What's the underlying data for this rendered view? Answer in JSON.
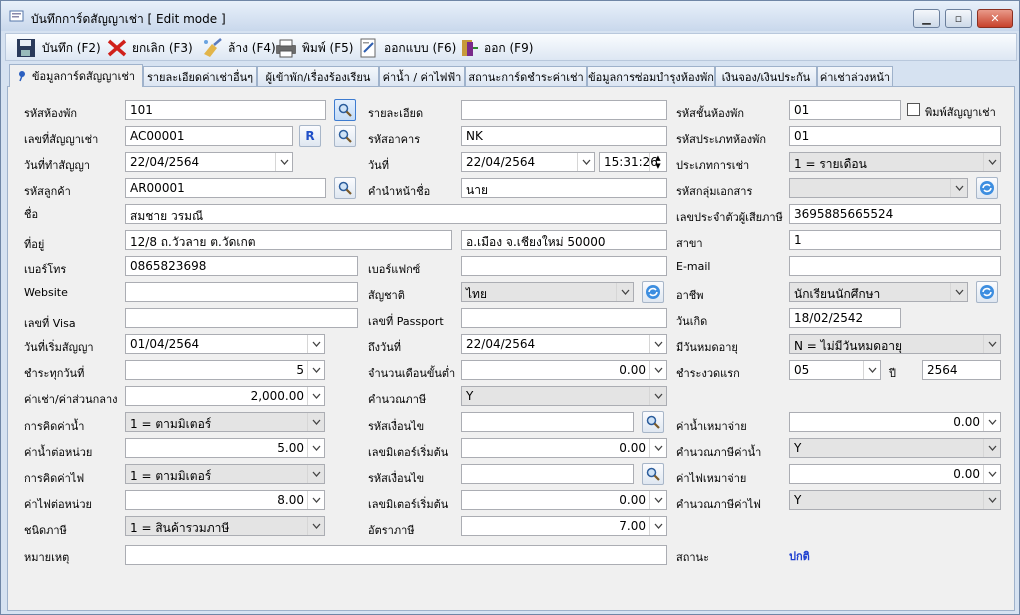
{
  "window": {
    "title": "บันทึกการ์ดสัญญาเช่า [ Edit mode ]"
  },
  "toolbar": {
    "save": "บันทึก (F2)",
    "cancel": "ยกเลิก (F3)",
    "clear": "ล้าง (F4)",
    "print": "พิมพ์ (F5)",
    "design": "ออกแบบ (F6)",
    "exit": "ออก (F9)"
  },
  "tabs": [
    "ข้อมูลการ์ดสัญญาเช่า",
    "รายละเอียดค่าเช่าอื่นๆ",
    "ผู้เข้าพัก/เรื่องร้องเรียน",
    "ค่าน้ำ / ค่าไฟฟ้า",
    "สถานะการ์ดชำระค่าเช่า",
    "ข้อมูลการซ่อมบำรุงห้องพัก",
    "เงินจอง/เงินประกัน",
    "ค่าเช่าล่วงหน้า"
  ],
  "labels": {
    "room_code": "รหัสห้องพัก",
    "detail": "รายละเอียด",
    "floor_code": "รหัสชั้นห้องพัก",
    "print_contract": "พิมพ์สัญญาเช่า",
    "contract_no": "เลขที่สัญญาเช่า",
    "building_code": "รหัสอาคาร",
    "room_type_code": "รหัสประเภทห้องพัก",
    "contract_date": "วันที่ทำสัญญา",
    "date": "วันที่",
    "rent_type": "ประเภทการเช่า",
    "customer_code": "รหัสลูกค้า",
    "prefix": "คำนำหน้าชื่อ",
    "doc_group": "รหัสกลุ่มเอกสาร",
    "name": "ชื่อ",
    "tax_id": "เลขประจำตัวผู้เสียภาษี",
    "address": "ที่อยู่",
    "branch": "สาขา",
    "phone": "เบอร์โทร",
    "fax": "เบอร์แฟกซ์",
    "email": "E-mail",
    "website": "Website",
    "nationality": "สัญชาติ",
    "occupation": "อาชีพ",
    "visa": "เลขที่ Visa",
    "passport": "เลขที่ Passport",
    "birthdate": "วันเกิด",
    "start_date": "วันที่เริ่มสัญญา",
    "end_date": "ถึงวันที่",
    "has_expiry": "มีวันหมดอายุ",
    "pay_every": "ชำระทุกวันที่",
    "min_months": "จำนวนเดือนขั้นต่ำ",
    "first_period": "ชำระงวดแรก",
    "year": "ปี",
    "rent_fee": "ค่าเช่า/ค่าส่วนกลาง",
    "calc_tax": "คำนวณภาษี",
    "water_calc": "การคิดค่าน้ำ",
    "condition_code": "รหัสเงื่อนไข",
    "water_lump": "ค่าน้ำเหมาจ่าย",
    "water_unit": "ค่าน้ำต่อหน่วย",
    "meter_start": "เลขมิเตอร์เริ่มต้น",
    "water_tax": "คำนวณภาษีค่าน้ำ",
    "elec_calc": "การคิดค่าไฟ",
    "elec_lump": "ค่าไฟเหมาจ่าย",
    "elec_unit": "ค่าไฟต่อหน่วย",
    "elec_tax": "คำนวณภาษีค่าไฟ",
    "tax_type": "ชนิดภาษี",
    "tax_rate": "อัตราภาษี",
    "remark": "หมายเหตุ",
    "status": "สถานะ"
  },
  "values": {
    "room_code": "101",
    "detail": "",
    "floor_code": "01",
    "contract_no": "AC00001",
    "r_button": "R",
    "building_code": "NK",
    "room_type_code": "01",
    "contract_date": "22/04/2564",
    "date": "22/04/2564",
    "time": "15:31:26",
    "rent_type": "1 = รายเดือน",
    "customer_code": "AR00001",
    "prefix": "นาย",
    "doc_group": "",
    "name": "สมชาย วรมณี",
    "tax_id": "3695885665524",
    "address1": "12/8 ถ.วัวลาย ต.วัดเกต",
    "address2": "อ.เมือง จ.เชียงใหม่ 50000",
    "branch": "1",
    "phone": "0865823698",
    "fax": "",
    "email": "",
    "website": "",
    "nationality": "ไทย",
    "occupation": "นักเรียนนักศึกษา",
    "visa": "",
    "passport": "",
    "birthdate": "18/02/2542",
    "start_date": "01/04/2564",
    "end_date": "22/04/2564",
    "has_expiry": "N = ไม่มีวันหมดอายุ",
    "pay_every": "5",
    "min_months": "0.00",
    "first_period": "05",
    "year": "2564",
    "rent_fee": "2,000.00",
    "calc_tax": "Y",
    "water_calc": "1 = ตามมิเตอร์",
    "water_condition": "",
    "water_lump": "0.00",
    "water_unit": "5.00",
    "water_meter_start": "0.00",
    "water_tax": "Y",
    "elec_calc": "1 = ตามมิเตอร์",
    "elec_condition": "",
    "elec_lump": "0.00",
    "elec_unit": "8.00",
    "elec_meter_start": "0.00",
    "elec_tax": "Y",
    "tax_type": "1 = สินค้ารวมภาษี",
    "tax_rate": "7.00",
    "remark": "",
    "status": "ปกติ"
  },
  "colors": {
    "status": "#1e3fd0",
    "accent": "#3d7bd0"
  }
}
